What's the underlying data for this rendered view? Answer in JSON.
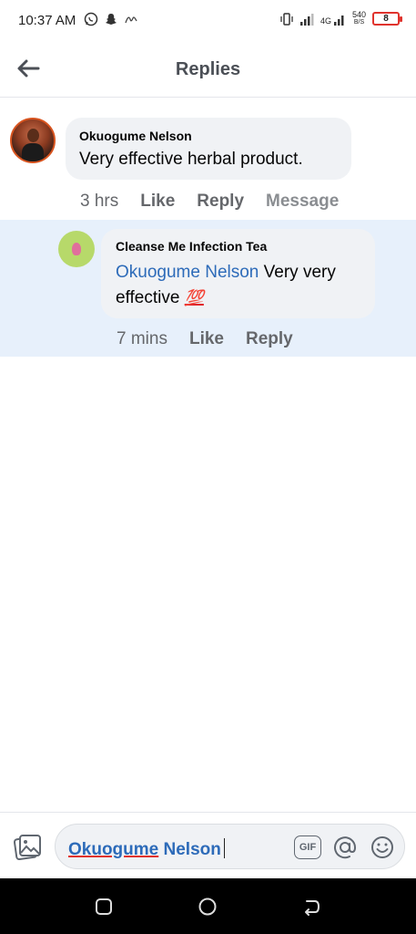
{
  "status_bar": {
    "time": "10:37 AM",
    "left_icons": [
      "whatsapp-icon",
      "snapchat-icon",
      "signature-icon"
    ],
    "network_4g": "4G",
    "speed_value": "540",
    "speed_unit": "B/S",
    "battery": "8",
    "battery_color": "#e0332d"
  },
  "header": {
    "title": "Replies",
    "back_icon": "arrow-left-icon"
  },
  "comment": {
    "author": "Okuogume Nelson",
    "text": "Very effective herbal product.",
    "time": "3 hrs",
    "like_label": "Like",
    "reply_label": "Reply",
    "message_label": "Message"
  },
  "reply": {
    "author": "Cleanse Me Infection Tea",
    "mention": "Okuogume Nelson",
    "text_after_mention": " Very very effective ",
    "emoji": "💯",
    "time": "7 mins",
    "like_label": "Like",
    "reply_label": "Reply",
    "background": "#e7f0fb"
  },
  "composer": {
    "photo_icon": "photo-icon",
    "value_first": "Okuogume",
    "value_second": " Nelson",
    "gif_label": "GIF",
    "at_icon": "at-sign-icon",
    "emoji_icon": "smiley-icon",
    "mention_color": "#2d6bb9"
  },
  "nav_bar": {
    "buttons": [
      "recent-apps-icon",
      "home-icon",
      "back-icon"
    ]
  }
}
